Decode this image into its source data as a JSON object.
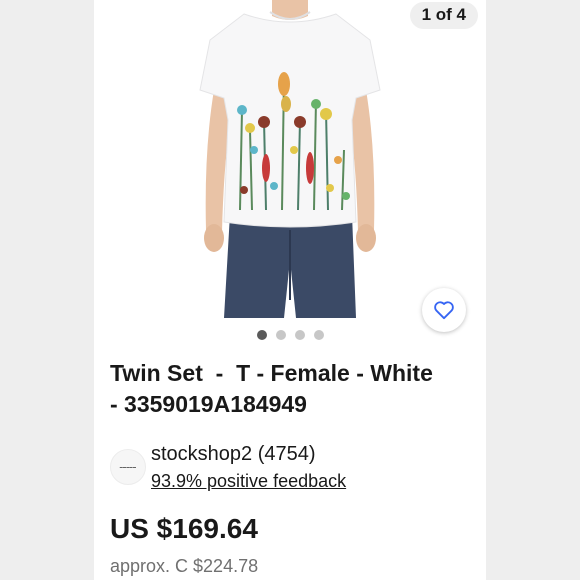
{
  "gallery": {
    "counter": "1 of 4",
    "dots_total": 4,
    "active_dot_index": 0,
    "photo_icon": "tshirt-photo"
  },
  "favorite": {
    "icon": "heart-outline-icon",
    "color": "#3665f3"
  },
  "listing": {
    "title": "Twin Set  -  T - Female - White\n- 3359019A184949",
    "price": "US $169.64",
    "approx_price": "approx. C $224.78"
  },
  "seller": {
    "name": "stockshop2 (4754)",
    "feedback": "93.9% positive feedback",
    "avatar_icon": "seller-logo"
  },
  "colors": {
    "text": "#191919",
    "muted": "#707070",
    "accent": "#3665f3"
  }
}
